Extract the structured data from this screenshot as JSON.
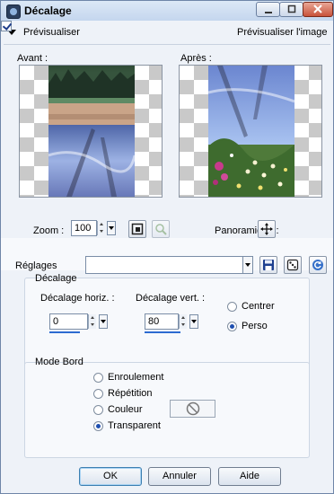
{
  "window": {
    "title": "Décalage"
  },
  "preview_bar": {
    "label": "Prévisualiser",
    "show_preview_label": "Prévisualiser l'image",
    "show_preview_checked": true
  },
  "preview": {
    "before_label": "Avant :",
    "after_label": "Après :"
  },
  "zoom": {
    "label": "Zoom :",
    "value": "100"
  },
  "pan": {
    "label": "Panoramique :"
  },
  "presets": {
    "label": "Réglages",
    "value": ""
  },
  "offset": {
    "title": "Décalage",
    "horiz_label": "Décalage horiz. :",
    "horiz_value": "0",
    "vert_label": "Décalage vert. :",
    "vert_value": "80",
    "options": [
      {
        "label": "Centrer",
        "selected": false
      },
      {
        "label": "Perso",
        "selected": true
      }
    ]
  },
  "edge_mode": {
    "title": "Mode Bord",
    "options": [
      {
        "label": "Enroulement",
        "selected": false
      },
      {
        "label": "Répétition",
        "selected": false
      },
      {
        "label": "Couleur",
        "selected": false
      },
      {
        "label": "Transparent",
        "selected": true
      }
    ]
  },
  "buttons": {
    "ok": "OK",
    "cancel": "Annuler",
    "help": "Aide"
  },
  "colors": {
    "accent": "#2d6bd1",
    "titlebar": "#c4d6ee",
    "close": "#c8523a"
  }
}
